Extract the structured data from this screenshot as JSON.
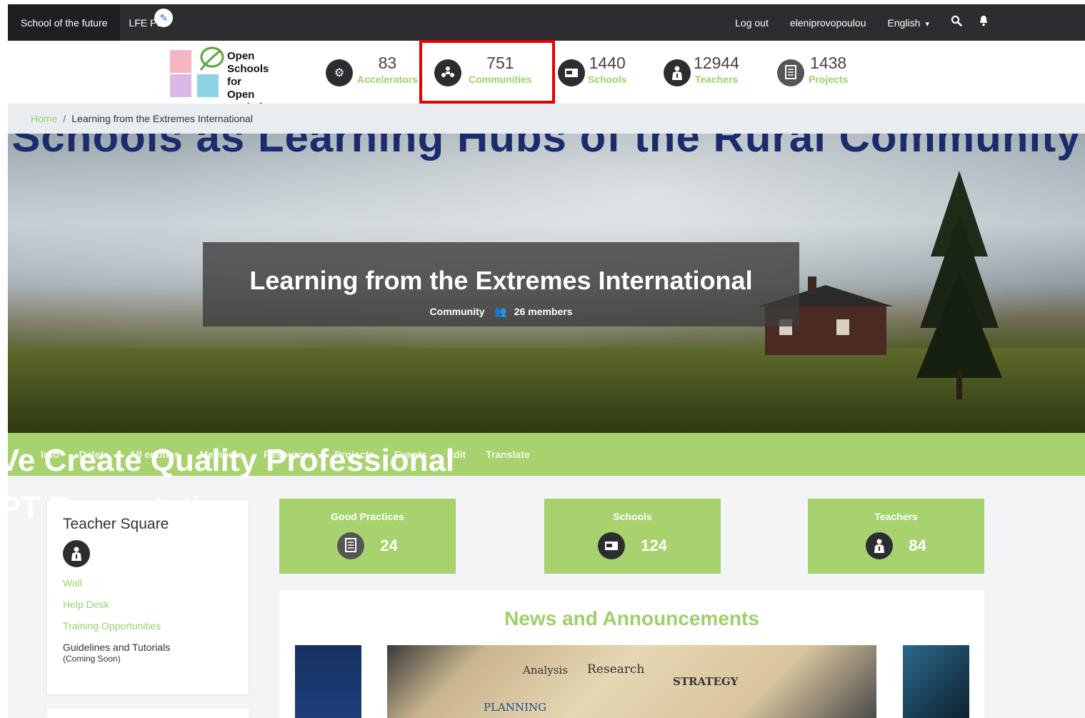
{
  "topbar": {
    "brand": "School of the future",
    "portal": "LFE Por",
    "logout": "Log out",
    "user": "eleniprovopoulou",
    "language": "English"
  },
  "logo": {
    "text": "Open\nSchools for\nOpen\nSocieties",
    "colors": [
      "#f4b6c2",
      "#dcb8e6",
      "#8fd3e8",
      "#5aa63a"
    ]
  },
  "stats": [
    {
      "icon": "gear-icon",
      "value": "83",
      "label": "Accelerators"
    },
    {
      "icon": "people-icon",
      "value": "751",
      "label": "Communities"
    },
    {
      "icon": "school-icon",
      "value": "1440",
      "label": "Schools"
    },
    {
      "icon": "teacher-icon",
      "value": "12944",
      "label": "Teachers"
    },
    {
      "icon": "document-icon",
      "value": "1438",
      "label": "Projects"
    }
  ],
  "breadcrumb": {
    "home": "Home",
    "separator": "/",
    "current": "Learning from the Extremes International"
  },
  "hero": {
    "ghost_text": "Schools as Learning Hubs of the Rural Community",
    "title": "Learning from the Extremes International",
    "type": "Community",
    "members": "26 members"
  },
  "menu": {
    "items": [
      "Info",
      "Delete",
      "All entities",
      "Members",
      "Resources",
      "Projects",
      "Events",
      "Edit",
      "Translate"
    ]
  },
  "overlay": {
    "line1": "Ve Create Quality Professional",
    "line2": "PT Presentation"
  },
  "sidebar": {
    "title": "Teacher Square",
    "links": [
      "Wall",
      "Help Desk",
      "Training Opportunities"
    ],
    "guidelines": "Guidelines and Tutorials",
    "coming_soon": "(Coming Soon)"
  },
  "boxes": [
    {
      "title": "Good Practices",
      "icon": "document-icon",
      "value": "24"
    },
    {
      "title": "Schools",
      "icon": "school-icon",
      "value": "124"
    },
    {
      "title": "Teachers",
      "icon": "teacher-icon",
      "value": "84"
    }
  ],
  "news": {
    "title": "News and Announcements",
    "slide_tags": [
      "Analysis",
      "Research",
      "STRATEGY",
      "PLANNING"
    ]
  },
  "colors": {
    "accent_green": "#a8d26e",
    "text_green": "#9cd16a",
    "dark": "#2b2d30",
    "highlight_red": "#e60000"
  }
}
